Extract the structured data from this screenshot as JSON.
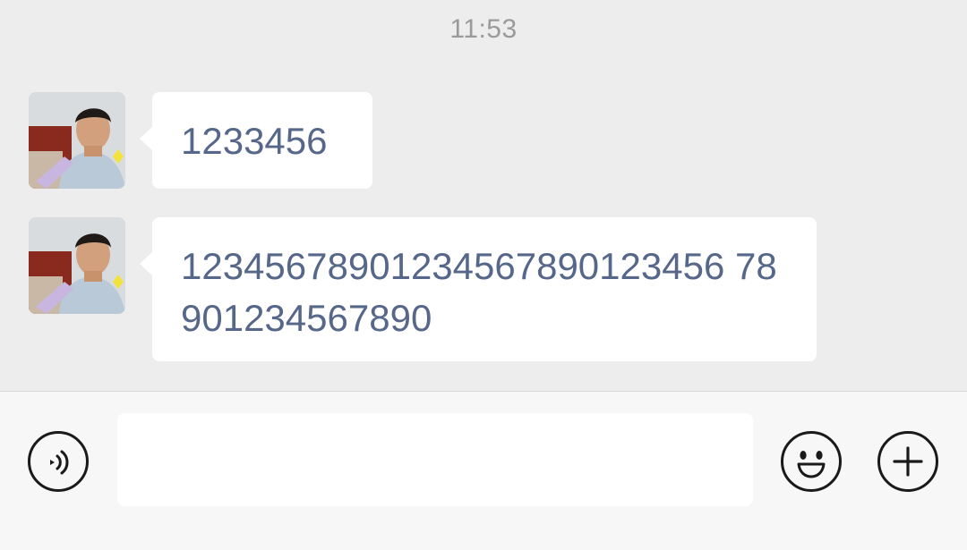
{
  "chat": {
    "timestamp": "11:53",
    "messages": [
      {
        "sender": "contact",
        "avatar_icon": "user-photo-avatar",
        "text": "1233456"
      },
      {
        "sender": "contact",
        "avatar_icon": "user-photo-avatar",
        "text": "12345678901234567890123456 78901234567890"
      }
    ]
  },
  "input_bar": {
    "text_value": "",
    "voice_icon": "voice-input-icon",
    "emoji_icon": "smiley-icon",
    "more_icon": "plus-icon"
  },
  "colors": {
    "background": "#ededed",
    "bubble": "#ffffff",
    "message_text": "#56678a",
    "timestamp_text": "#9a9a9a",
    "input_bar": "#f7f7f7"
  }
}
